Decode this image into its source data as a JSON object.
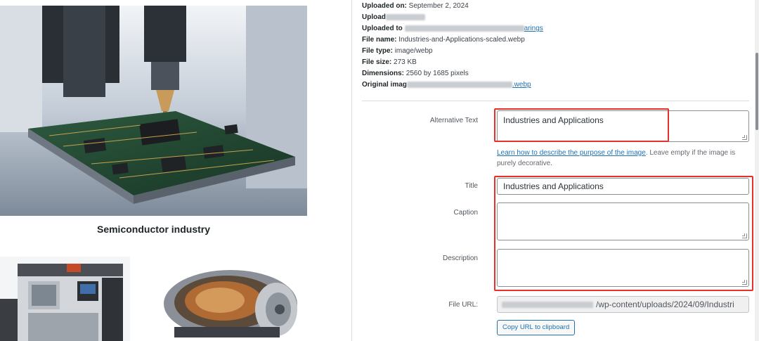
{
  "preview": {
    "caption": "Semiconductor industry",
    "images": [
      "semiconductor-pcb-photo",
      "cnc-machine-photo",
      "engine-cutaway-photo"
    ]
  },
  "meta": {
    "uploaded_on_label": "Uploaded on:",
    "uploaded_on_value": "September 2, 2024",
    "uploaded_by_label": "Upload",
    "uploaded_to_label": "Uploaded to",
    "uploaded_to_link_tail": "arings",
    "file_name_label": "File name:",
    "file_name_value": "Industries-and-Applications-scaled.webp",
    "file_type_label": "File type:",
    "file_type_value": "image/webp",
    "file_size_label": "File size:",
    "file_size_value": "273 KB",
    "dimensions_label": "Dimensions:",
    "dimensions_value": "2560 by 1685 pixels",
    "original_label": "Original imag",
    "original_link_tail": ".webp"
  },
  "fields": {
    "alt_label": "Alternative Text",
    "alt_value": "Industries and Applications",
    "alt_help_link": "Learn how to describe the purpose of the image",
    "alt_help_text": ". Leave empty if the image is purely decorative.",
    "title_label": "Title",
    "title_value": "Industries and Applications",
    "caption_label": "Caption",
    "caption_value": "",
    "description_label": "Description",
    "description_value": "",
    "file_url_label": "File URL:",
    "file_url_value": "/wp-content/uploads/2024/09/Industri",
    "copy_button": "Copy URL to clipboard"
  },
  "colors": {
    "highlight": "#e5302b",
    "link": "#2271b1"
  }
}
